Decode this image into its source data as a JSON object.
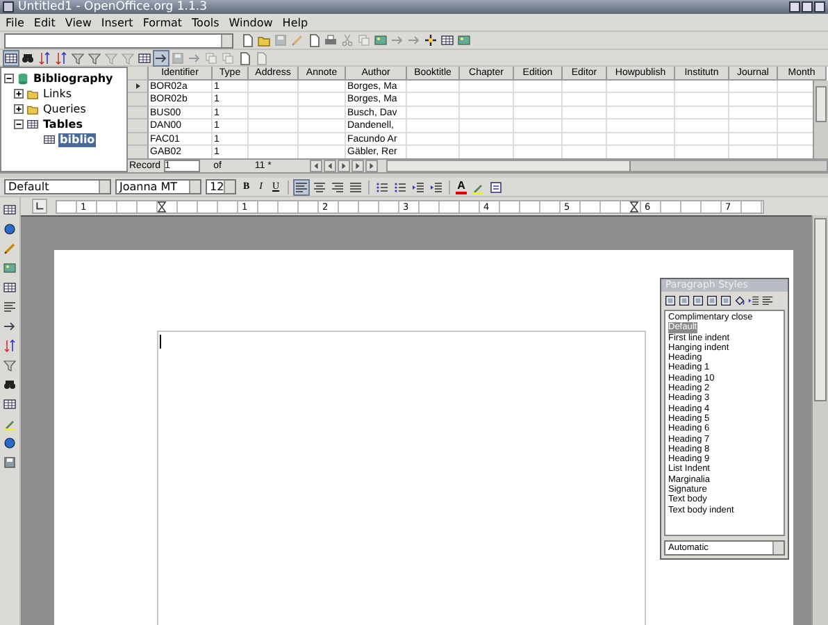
{
  "window": {
    "title": "Untitled1 - OpenOffice.org 1.1.3"
  },
  "menu": [
    "File",
    "Edit",
    "View",
    "Insert",
    "Format",
    "Tools",
    "Window",
    "Help"
  ],
  "datasource_tree": [
    {
      "label": "Bibliography",
      "expanded": true,
      "children": [
        {
          "label": "Links",
          "expanded": false,
          "kind": "links"
        },
        {
          "label": "Queries",
          "expanded": false,
          "kind": "queries"
        },
        {
          "label": "Tables",
          "expanded": true,
          "kind": "tables",
          "children": [
            {
              "label": "biblio",
              "selected": true,
              "kind": "table"
            }
          ]
        }
      ]
    }
  ],
  "table": {
    "columns": [
      "Identifier",
      "Type",
      "Address",
      "Annote",
      "Author",
      "Booktitle",
      "Chapter",
      "Edition",
      "Editor",
      "Howpublish",
      "Institutn",
      "Journal",
      "Month"
    ],
    "rows": [
      {
        "current": true,
        "cells": [
          "BOR02a",
          "1",
          "",
          "",
          "Borges, Ma"
        ]
      },
      {
        "current": false,
        "cells": [
          "BOR02b",
          "1",
          "",
          "",
          "Borges, Ma"
        ]
      },
      {
        "current": false,
        "cells": [
          "BUS00",
          "1",
          "",
          "",
          "Busch, Dav"
        ]
      },
      {
        "current": false,
        "cells": [
          "DAN00",
          "1",
          "",
          "",
          "Dandenell,"
        ]
      },
      {
        "current": false,
        "cells": [
          "FAC01",
          "1",
          "",
          "",
          "Facundo Ar"
        ]
      },
      {
        "current": false,
        "cells": [
          "GAB02",
          "1",
          "",
          "",
          "Gäbler, Rer"
        ]
      }
    ],
    "record_bar": {
      "label": "Record",
      "value": "1",
      "of": "of",
      "count": "11 *"
    }
  },
  "formatting": {
    "style": "Default",
    "font": "Joanna MT",
    "size": "12",
    "char_buttons": [
      "B",
      "I",
      "U"
    ],
    "alignment_buttons": [
      {
        "kind": "left",
        "selected": true
      },
      {
        "kind": "center",
        "selected": false
      },
      {
        "kind": "right",
        "selected": false
      },
      {
        "kind": "justify",
        "selected": false
      }
    ],
    "font_color_glyph": "A"
  },
  "ruler": {
    "labels": [
      "1",
      "1",
      "2",
      "3",
      "4",
      "5",
      "6",
      "7"
    ]
  },
  "styles_window": {
    "title": "Paragraph Styles",
    "items": [
      {
        "label": "Complimentary close",
        "selected": false
      },
      {
        "label": "Default",
        "selected": true
      },
      {
        "label": "First line indent",
        "selected": false
      },
      {
        "label": "Hanging indent",
        "selected": false
      },
      {
        "label": "Heading",
        "selected": false
      },
      {
        "label": "Heading 1",
        "selected": false
      },
      {
        "label": "Heading 10",
        "selected": false
      },
      {
        "label": "Heading 2",
        "selected": false
      },
      {
        "label": "Heading 3",
        "selected": false
      },
      {
        "label": "Heading 4",
        "selected": false
      },
      {
        "label": "Heading 5",
        "selected": false
      },
      {
        "label": "Heading 6",
        "selected": false
      },
      {
        "label": "Heading 7",
        "selected": false
      },
      {
        "label": "Heading 8",
        "selected": false
      },
      {
        "label": "Heading 9",
        "selected": false
      },
      {
        "label": "List Indent",
        "selected": false
      },
      {
        "label": "Marginalia",
        "selected": false
      },
      {
        "label": "Signature",
        "selected": false
      },
      {
        "label": "Text body",
        "selected": false
      },
      {
        "label": "Text body indent",
        "selected": false
      }
    ],
    "filter": "Automatic"
  }
}
